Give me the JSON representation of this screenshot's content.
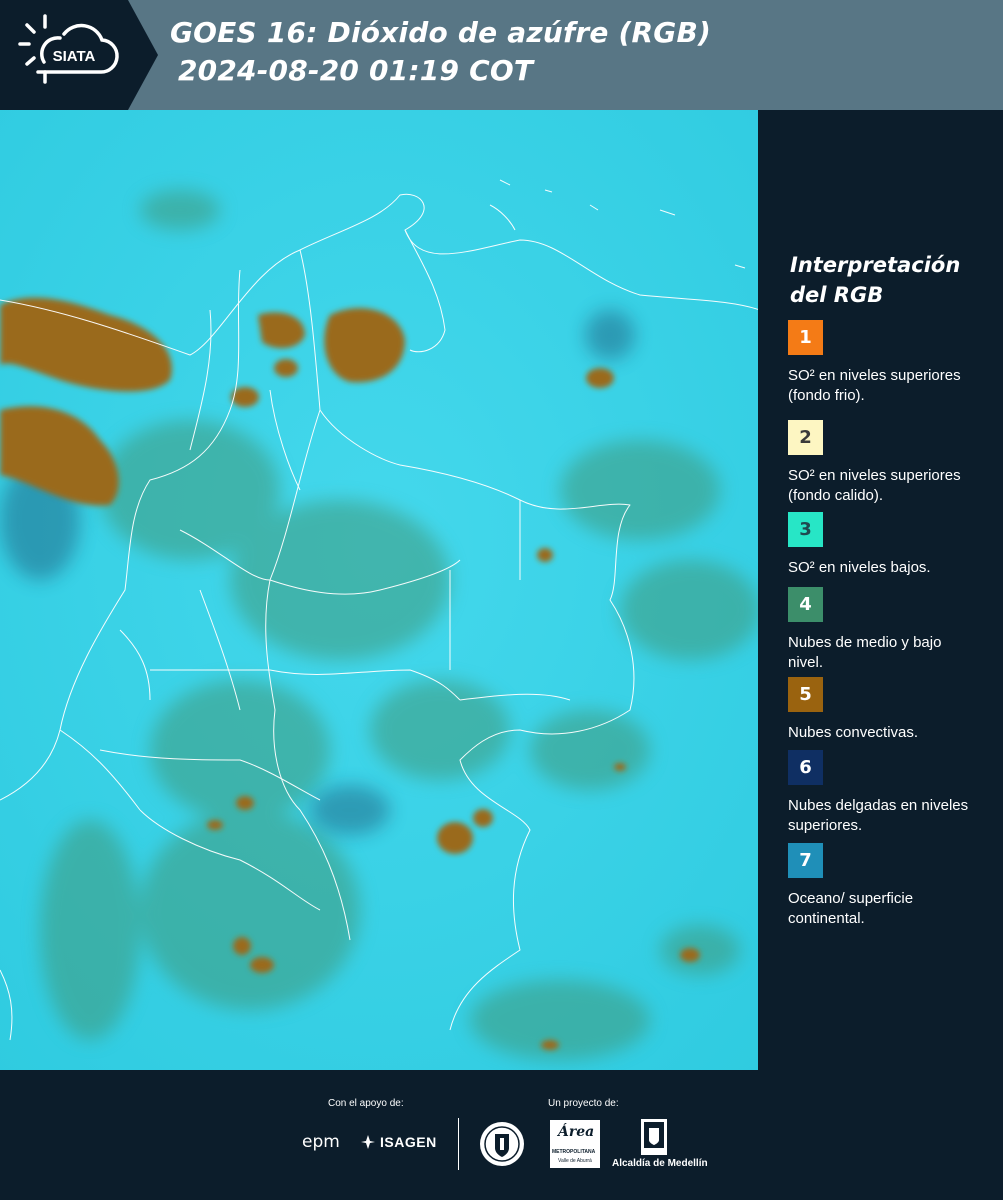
{
  "header": {
    "logo_text": "SIATA",
    "title_line1": "GOES 16: Dióxido de azúfre (RGB)",
    "title_line2": "2024-08-20 01:19 COT"
  },
  "legend": {
    "title_line1": "Interpretación",
    "title_line2": "del RGB",
    "items": [
      {
        "number": "1",
        "color": "#f47b16",
        "text_color": "#ffffff",
        "description": "SO² en niveles superiores (fondo frio)."
      },
      {
        "number": "2",
        "color": "#fdf6c2",
        "text_color": "#3a3a3a",
        "description": "SO² en niveles superiores (fondo calido)."
      },
      {
        "number": "3",
        "color": "#27e6c6",
        "text_color": "#1f4a50",
        "description": "SO² en niveles bajos."
      },
      {
        "number": "4",
        "color": "#3c8e6a",
        "text_color": "#ffffff",
        "description": "Nubes de medio y bajo nivel."
      },
      {
        "number": "5",
        "color": "#9a630f",
        "text_color": "#ffffff",
        "description": "Nubes convectivas."
      },
      {
        "number": "6",
        "color": "#0f2f63",
        "text_color": "#ffffff",
        "description": "Nubes delgadas en niveles superiores."
      },
      {
        "number": "7",
        "color": "#1f8fb8",
        "text_color": "#ffffff",
        "description": "Oceano/ superficie continental."
      }
    ]
  },
  "footer": {
    "support_label": "Con el apoyo de:",
    "project_label": "Un proyecto de:",
    "sponsors": [
      "epm",
      "ISAGEN"
    ],
    "partners": [
      "Área",
      "METROPOLITANA",
      "Valle de Aburrá",
      "Alcaldía de Medellín"
    ]
  },
  "colors": {
    "header_bg": "#587685",
    "panel_bg": "#0c1d2b",
    "map_bg": "#34cfe2"
  }
}
